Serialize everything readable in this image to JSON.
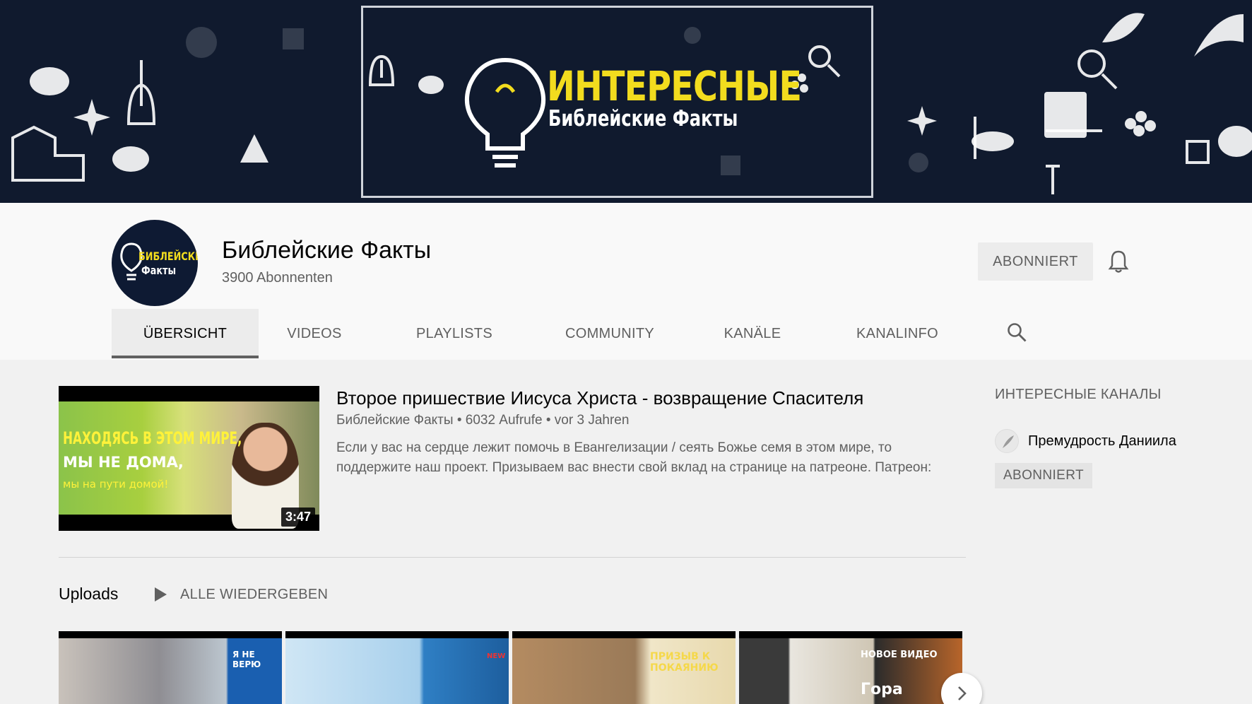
{
  "banner": {
    "title": "ИНТЕРЕСНЫЕ",
    "subtitle": "Библейские Факты"
  },
  "avatar": {
    "line1": "БИБЛЕЙСКИЕ",
    "line2": "Факты"
  },
  "channel": {
    "name": "Библейские Факты",
    "subscribers": "3900 Abonnenten",
    "subscribe_label": "ABONNIERT"
  },
  "tabs": [
    {
      "label": "ÜBERSICHT",
      "active": true
    },
    {
      "label": "VIDEOS"
    },
    {
      "label": "PLAYLISTS"
    },
    {
      "label": "COMMUNITY"
    },
    {
      "label": "KANÄLE"
    },
    {
      "label": "KANALINFO"
    }
  ],
  "featured": {
    "thumb_line1": "НАХОДЯСЬ В ЭТОМ МИРЕ,",
    "thumb_line2": "МЫ НЕ ДОМА,",
    "thumb_line3": "мы на пути домой!",
    "duration": "3:47",
    "title": "Второе пришествие Иисуса Христа - возвращение Спасителя",
    "channel": "Библейские Факты",
    "views": "6032 Aufrufe",
    "age": "vor 3 Jahren",
    "description": "Если у вас на сердце лежит помочь в Евангелизации / сеять Божье семя в этом мире, то поддержите наш проект. Призываем вас внести свой вклад на странице на патреоне. Патреон:"
  },
  "uploads": {
    "label": "Uploads",
    "play_all": "ALLE WIEDERGEBEN",
    "thumbs": [
      {
        "text": "Я НЕ ВЕРЮ"
      },
      {
        "text": "NEW"
      },
      {
        "text": "ПРИЗЫВ К ПОКАЯНИЮ"
      },
      {
        "text": "НОВОЕ ВИДЕО",
        "text2": "Гора"
      }
    ]
  },
  "sidebar": {
    "title": "ИНТЕРЕСНЫЕ КАНАЛЫ",
    "channel_name": "Премудрость Даниила",
    "button": "ABONNIERT"
  },
  "colors": {
    "banner_bg": "#101a2e",
    "banner_title": "#f2dc1e",
    "text_secondary": "#606060"
  }
}
